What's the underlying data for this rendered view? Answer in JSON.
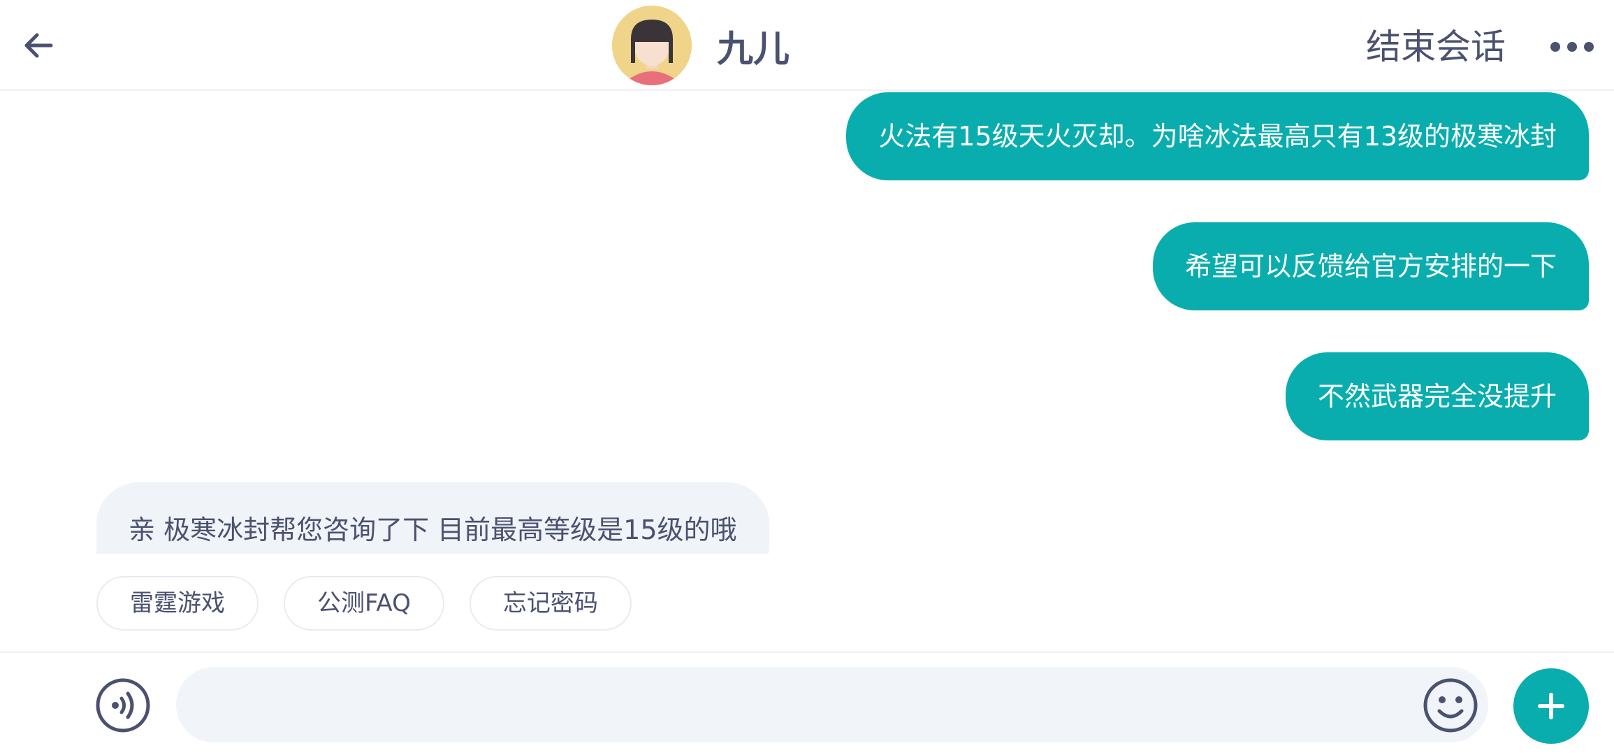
{
  "header": {
    "agent_name": "九儿",
    "end_chat_label": "结束会话",
    "back_icon": "arrow-left-icon",
    "more_icon": "more-dots-icon"
  },
  "messages": [
    {
      "side": "out",
      "text": "火法有15级天火灭却。为啥冰法最高只有13级的极寒冰封"
    },
    {
      "side": "out",
      "text": "希望可以反馈给官方安排的一下"
    },
    {
      "side": "out",
      "text": "不然武器完全没提升"
    },
    {
      "side": "in",
      "text": "亲 极寒冰封帮您咨询了下 目前最高等级是15级的哦"
    }
  ],
  "quick_replies": [
    "雷霆游戏",
    "公测FAQ",
    "忘记密码"
  ],
  "input_bar": {
    "placeholder": "",
    "voice_icon": "voice-icon",
    "emoji_icon": "emoji-icon",
    "plus_icon": "plus-icon"
  },
  "colors": {
    "accent": "#0aadad",
    "text": "#4b5170",
    "incoming_bg": "#f0f3f7"
  }
}
